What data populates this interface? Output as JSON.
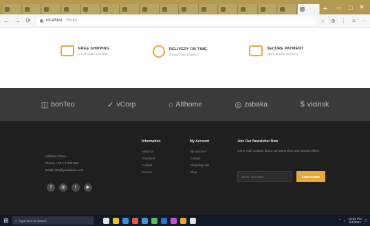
{
  "browser": {
    "tab_count": 16,
    "active_tab_index": 15,
    "new_tab_symbol": "+",
    "window_controls": [
      "—",
      "□",
      "✕"
    ],
    "address": {
      "back": "←",
      "forward": "→",
      "reload": "⟳",
      "url_host": "localhost",
      "url_rest": "/Shop/",
      "toolbar_icons": [
        "☆",
        "⊕",
        "⋮",
        "≡",
        "⋯"
      ]
    }
  },
  "features": [
    {
      "title": "FREE SHIPPING",
      "subtitle": "On all order over $99",
      "icon": "truck-icon"
    },
    {
      "title": "DELIVERY ON TIME",
      "subtitle": "If good have prolems",
      "icon": "clock-icon"
    },
    {
      "title": "SECURE PAYMENT",
      "subtitle": "100% secure payment",
      "icon": "card-icon"
    }
  ],
  "brands": [
    {
      "name": "bonTeo",
      "icon": "◫"
    },
    {
      "name": "vCorp",
      "icon": "✓"
    },
    {
      "name": "Althome",
      "icon": "⌂"
    },
    {
      "name": "zabaka",
      "icon": "◎"
    },
    {
      "name": "vicinsk",
      "icon": "$"
    }
  ],
  "footer": {
    "contact": {
      "address": "Address: Place",
      "phone": "Phone: +01 1 1 000 000",
      "email": "Email: info@yourname.com"
    },
    "socials": [
      "f",
      "◎",
      "t",
      "▶"
    ],
    "columns": [
      {
        "heading": "Information",
        "links": [
          "About us",
          "Checkout",
          "Contact",
          "Service"
        ]
      },
      {
        "heading": "My Account",
        "links": [
          "My account",
          "Contact",
          "Shopping cart",
          "Shop"
        ]
      }
    ],
    "newsletter": {
      "heading": "Join Our Newsletter Now",
      "description": "Get E-mail updates about our latest shop and special offers.",
      "placeholder": "Enter Your Mail",
      "button": "SUBSCRIBE"
    }
  },
  "taskbar": {
    "search_placeholder": "Type here to search",
    "apps": [
      "#e2e2e2",
      "#f0c419",
      "#3c8dde",
      "#e25c3c",
      "#3a9ad9",
      "#5bbd57",
      "#2b6fcf",
      "#c84fd1",
      "#f5a623",
      "#e2e2e2"
    ],
    "tray_time": "10:05 PM",
    "tray_date": "6/4/2021"
  },
  "colors": {
    "accent": "#e8a93a",
    "brand_band": "#3a3a3a",
    "footer_bg": "#1f1f1f",
    "tab_strip": "#b39a52"
  }
}
